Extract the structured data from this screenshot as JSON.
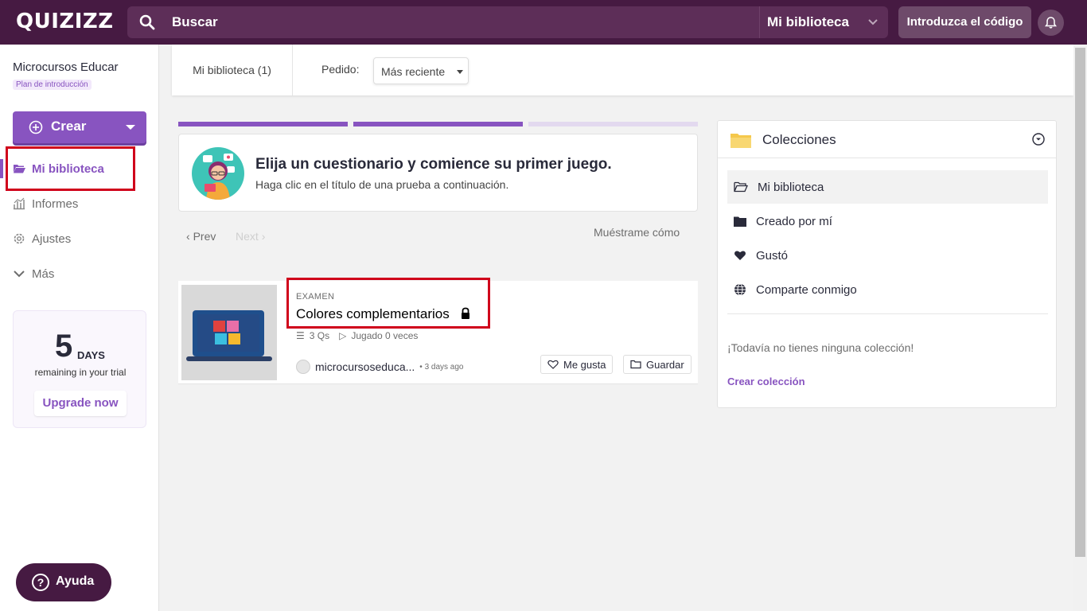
{
  "brand": {
    "logo": "QUIZIZZ"
  },
  "topbar": {
    "search_placeholder": "Buscar",
    "library_select": "Mi biblioteca",
    "code_button": "Introduzca el código"
  },
  "sidebar": {
    "org_name": "Microcursos Educar",
    "plan": "Plan de introducción",
    "create_label": "Crear",
    "items": [
      {
        "label": "Mi biblioteca",
        "icon": "folder-open-icon",
        "active": true
      },
      {
        "label": "Informes",
        "icon": "chart-icon",
        "active": false
      },
      {
        "label": "Ajustes",
        "icon": "gear-icon",
        "active": false
      },
      {
        "label": "Más",
        "icon": "chevron-down-icon",
        "active": false
      }
    ],
    "trial": {
      "number": "5",
      "unit": "DAYS",
      "subtitle": "remaining in your trial",
      "upgrade": "Upgrade now"
    },
    "help": "Ayuda"
  },
  "main": {
    "tab": "Mi biblioteca (1)",
    "order_label": "Pedido:",
    "order_value": "Más reciente",
    "intro": {
      "title": "Elija un cuestionario y comience su primer juego.",
      "subtitle": "Haga clic en el título de una prueba a continuación."
    },
    "prev": "Prev",
    "next": "Next",
    "show_how": "Muéstrame cómo",
    "quiz": {
      "type": "EXAMEN",
      "title": "Colores complementarios",
      "questions": "3 Qs",
      "played": "Jugado 0 veces",
      "author": "microcursoseduca...",
      "time": "3 days ago",
      "like": "Me gusta",
      "save": "Guardar"
    }
  },
  "collections": {
    "title": "Colecciones",
    "items": [
      {
        "label": "Mi biblioteca",
        "icon": "folder-open-icon"
      },
      {
        "label": "Creado por mí",
        "icon": "folder-icon"
      },
      {
        "label": "Gustó",
        "icon": "heart-icon"
      },
      {
        "label": "Comparte conmigo",
        "icon": "globe-icon"
      }
    ],
    "empty": "¡Todavía no tienes ninguna colección!",
    "create": "Crear colección"
  },
  "colors": {
    "brand": "#461a42",
    "accent": "#8854c0",
    "highlight": "#d0021b"
  }
}
